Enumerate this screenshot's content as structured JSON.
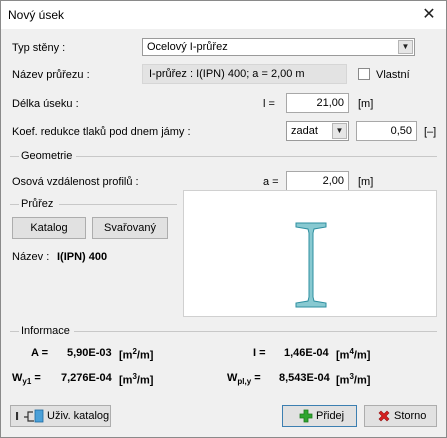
{
  "window": {
    "title": "Nový úsek",
    "close_glyph": "✕"
  },
  "fields": {
    "typ_steny": {
      "label": "Typ stěny :",
      "value": "Ocelový I-průřez"
    },
    "nazev_prurezu": {
      "label": "Název průřezu :",
      "value": "I-průřez : I(IPN) 400; a = 2,00 m",
      "vlastni_label": "Vlastní",
      "vlastni_checked": false
    },
    "delka_useku": {
      "label": "Délka úseku :",
      "symbol": "l =",
      "value": "21,00",
      "unit": "[m]"
    },
    "koef_redukce": {
      "label": "Koef. redukce tlaků pod dnem jámy :",
      "mode": "zadat",
      "value": "0,50",
      "unit": "[–]"
    }
  },
  "geometrie": {
    "title": "Geometrie",
    "osova": {
      "label": "Osová vzdálenost profilů :",
      "symbol": "a =",
      "value": "2,00",
      "unit": "[m]"
    }
  },
  "prurez": {
    "title": "Průřez",
    "katalog_label": "Katalog",
    "svarovany_label": "Svařovaný",
    "nazev_label": "Název :",
    "nazev_value": "I(IPN) 400",
    "section_color": "#88c9d1",
    "section_stroke": "#2e8fa0"
  },
  "informace": {
    "title": "Informace",
    "A_sym": "A =",
    "A_val": "5,90E-03",
    "A_unit_pre": "[m",
    "A_unit_exp": "2",
    "A_unit_post": "/m]",
    "I_sym": "I =",
    "I_val": "1,46E-04",
    "I_unit_pre": "[m",
    "I_unit_exp": "4",
    "I_unit_post": "/m]",
    "Wy_sym": "W",
    "Wy_sub": "y1",
    "Wy_eq": "=",
    "Wy_val": "7,276E-04",
    "Wy_unit_pre": "[m",
    "Wy_unit_exp": "3",
    "Wy_unit_post": "/m]",
    "Wpl_sym": "W",
    "Wpl_sub": "pl,y",
    "Wpl_eq": "=",
    "Wpl_val": "8,543E-04",
    "Wpl_unit_pre": "[m",
    "Wpl_unit_exp": "3",
    "Wpl_unit_post": "/m]"
  },
  "footer": {
    "uziv_katalog_label": "Uživ. katalog",
    "pridej_label": "Přidej",
    "storno_label": "Storno",
    "pridej_icon_color": "#2fa52f",
    "storno_icon_color": "#d62020"
  }
}
